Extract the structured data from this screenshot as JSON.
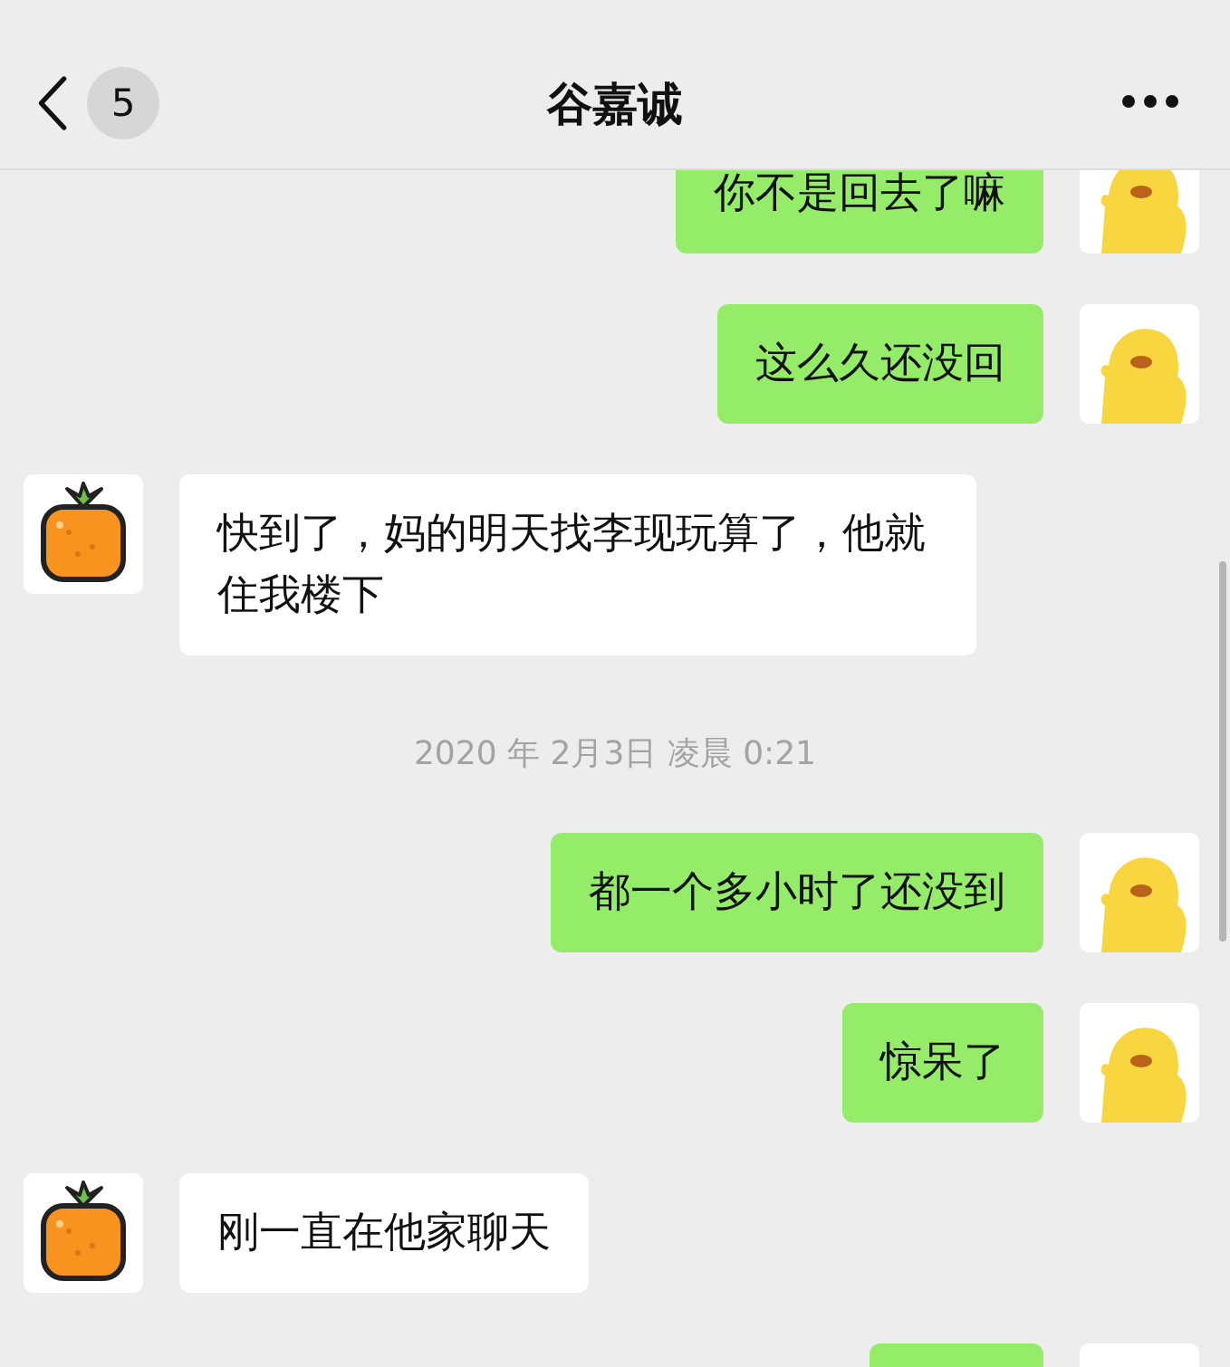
{
  "header": {
    "unread_count": "5",
    "title": "谷嘉诚"
  },
  "messages": [
    {
      "kind": "sent",
      "text": "你不是回去了嘛"
    },
    {
      "kind": "sent",
      "text": "这么久还没回"
    },
    {
      "kind": "received",
      "text": "快到了，妈的明天找李现玩算了，他就住我楼下"
    },
    {
      "kind": "time",
      "text": "2020 年 2月3日 凌晨 0:21"
    },
    {
      "kind": "sent",
      "text": "都一个多小时了还没到"
    },
    {
      "kind": "sent",
      "text": "惊呆了"
    },
    {
      "kind": "received",
      "text": "刚一直在他家聊天"
    },
    {
      "kind": "sent"
    }
  ]
}
